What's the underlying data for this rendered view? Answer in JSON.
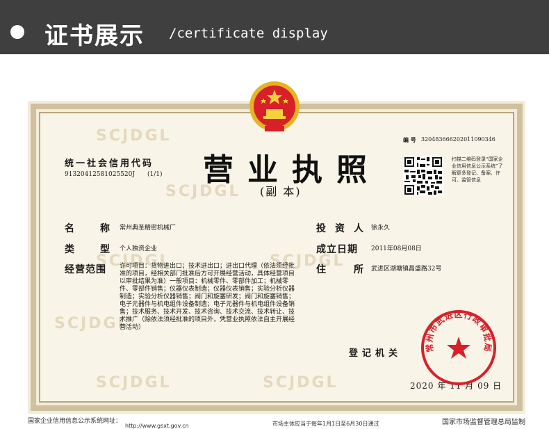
{
  "header": {
    "title": "证书展示",
    "subtitle": "/certificate display"
  },
  "certificate": {
    "credit_code_title": "统一社会信用代码",
    "credit_code": "91320412581025520J",
    "page_of": "(1/1)",
    "title": "营业执照",
    "subtitle": "(副 本)",
    "number_label": "编 号",
    "number": "320483666202011090346",
    "qr_note": "扫描二维码登录“国家企业信用信息公示系统”了解更多登记、备案、许可、监管信息",
    "fields": {
      "name_label": [
        "名",
        "称"
      ],
      "name": "常州典圣精密机械厂",
      "type_label": [
        "类",
        "型"
      ],
      "type": "个人独资企业",
      "scope_label": "经营范围",
      "scope": "许可项目：货物进出口；技术进出口；进出口代理（依法须经批准的项目，经相关部门批准后方可开展经营活动，具体经营项目以审批结果为准）一般项目：机械零件、零部件加工；机械零件、零部件销售；仪器仪表制造；仪器仪表销售；实验分析仪器制造；实验分析仪器销售；阀门和旋塞研发；阀门和旋塞销售；电子元器件与机电组件设备制造；电子元器件与机电组件设备销售；技术服务、技术开发、技术咨询、技术交流、技术转让、技术推广（除依法须经批准的项目外，凭营业执照依法自主开展经营活动）",
      "investor_label": [
        "投",
        "资",
        "人"
      ],
      "investor": "徐永久",
      "date_label": "成立日期",
      "date": "2011年08月08日",
      "address_label": [
        "住",
        "所"
      ],
      "address": "武进区湖塘镇昌盛路32号"
    },
    "registration_authority": "登记机关",
    "issue_date": "2020 年 11 月 09 日",
    "seal_text": "常州市武进区行政审批局",
    "watermark": "SCJDGL"
  },
  "footer": {
    "left": "国家企业信用信息公示系统网址：",
    "url": "http://www.gsxt.gov.cn",
    "middle": "市场主体应当于每年1月1日至6月30日通过",
    "right": "国家市场监督管理总局监制"
  },
  "colors": {
    "header_bg": "#3f3f3f",
    "paper": "#f8f4e7",
    "frame": "#cfc1a0",
    "seal_red": "#d8202a",
    "emblem_red": "#d8202a",
    "emblem_gold": "#e6b422"
  }
}
